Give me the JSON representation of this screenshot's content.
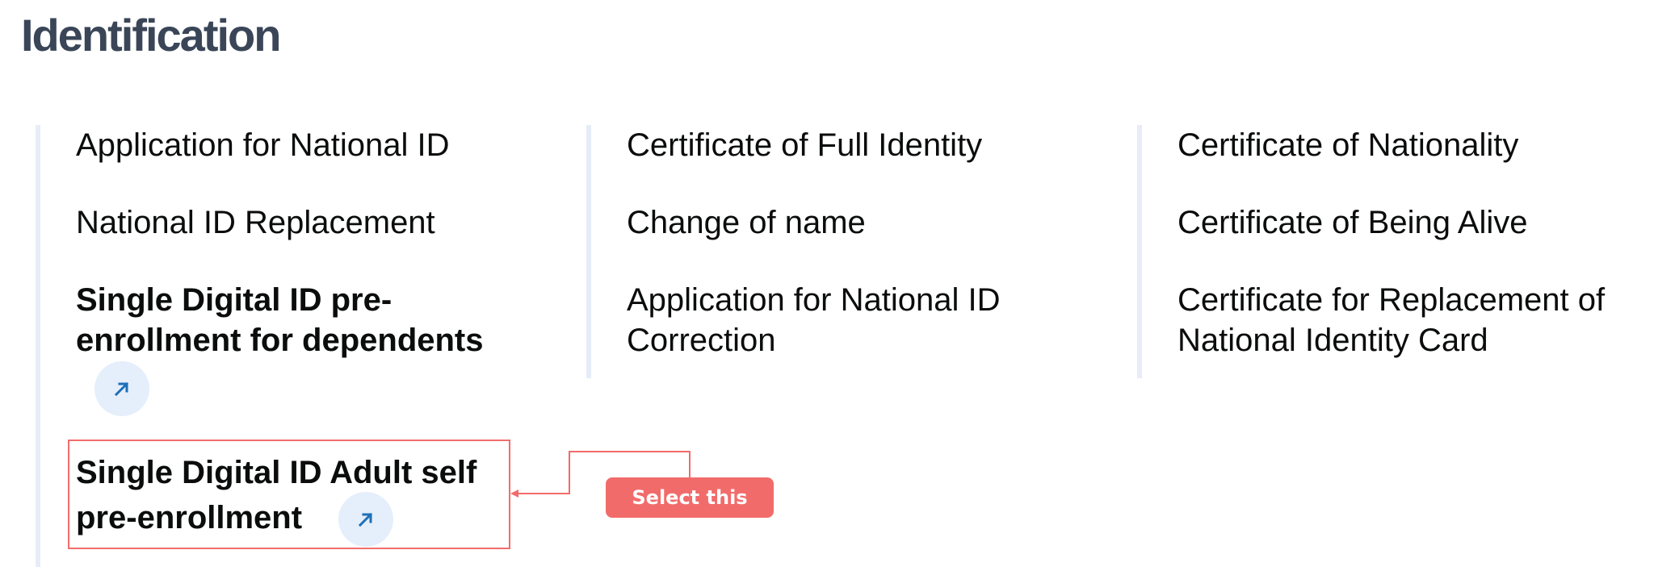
{
  "page": {
    "title": "Identification"
  },
  "columns": [
    {
      "items": [
        {
          "label": "Application for National ID"
        },
        {
          "label": "National ID Replacement"
        },
        {
          "label_lines": [
            "Single Digital ID pre-",
            "enrollment for dependents"
          ],
          "icon": "external-link-arrow-icon"
        },
        {
          "label_lines": [
            "Single Digital ID Adult self",
            "pre-enrollment"
          ],
          "icon": "external-link-arrow-icon",
          "highlighted": true
        }
      ]
    },
    {
      "items": [
        {
          "label": "Certificate of Full Identity"
        },
        {
          "label": "Change of name"
        },
        {
          "label_lines": [
            "Application for National ID",
            "Correction"
          ]
        }
      ]
    },
    {
      "items": [
        {
          "label": "Certificate of Nationality"
        },
        {
          "label": "Certificate of Being Alive"
        },
        {
          "label_lines": [
            "Certificate for Replacement of",
            "National Identity Card"
          ]
        }
      ]
    }
  ],
  "annotation": {
    "callout_text": "Select this"
  },
  "colors": {
    "heading": "#3a4658",
    "column_rule": "#e7ecf8",
    "icon_bg": "#e5eefb",
    "icon_arrow": "#1d70b8",
    "annotation_red": "#f26b6b"
  }
}
